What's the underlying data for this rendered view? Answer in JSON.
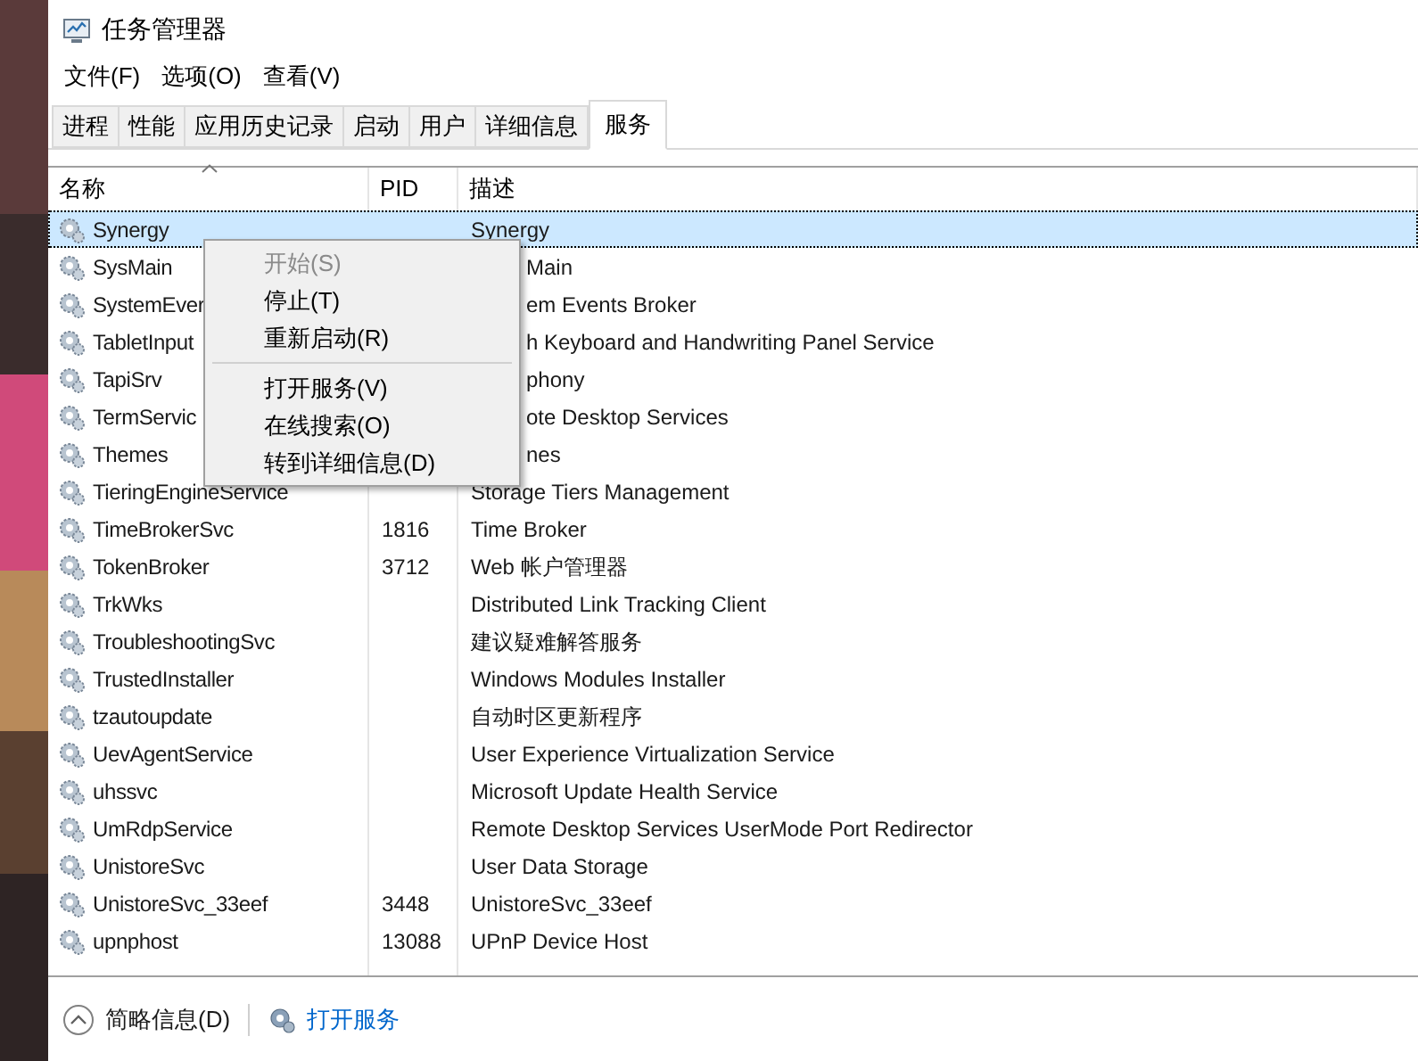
{
  "window": {
    "title": "任务管理器"
  },
  "menu_bar": [
    "文件(F)",
    "选项(O)",
    "查看(V)"
  ],
  "tabs": [
    {
      "label": "进程",
      "selected": false
    },
    {
      "label": "性能",
      "selected": false
    },
    {
      "label": "应用历史记录",
      "selected": false
    },
    {
      "label": "启动",
      "selected": false
    },
    {
      "label": "用户",
      "selected": false
    },
    {
      "label": "详细信息",
      "selected": false
    },
    {
      "label": "服务",
      "selected": true
    }
  ],
  "table": {
    "columns": [
      "名称",
      "PID",
      "描述"
    ],
    "rows": [
      {
        "name": "Synergy",
        "description": "Synergy",
        "selected": true
      },
      {
        "name": "SysMain",
        "description": "Main",
        "selected": false
      },
      {
        "name": "SystemEver",
        "description": "em Events Broker",
        "selected": false
      },
      {
        "name": "TabletInput",
        "description": "h Keyboard and Handwriting Panel Service",
        "selected": false
      },
      {
        "name": "TapiSrv",
        "description": "phony",
        "selected": false
      },
      {
        "name": "TermServic",
        "description": "ote Desktop Services",
        "selected": false
      },
      {
        "name": "Themes",
        "description": "nes",
        "selected": false
      },
      {
        "name": "TieringEngineService",
        "description": "Storage Tiers Management",
        "selected": false
      },
      {
        "name": "TimeBrokerSvc",
        "pid": "1816",
        "description": "Time Broker",
        "selected": false
      },
      {
        "name": "TokenBroker",
        "pid": "3712",
        "description": "Web 帐户管理器",
        "selected": false
      },
      {
        "name": "TrkWks",
        "description": "Distributed Link Tracking Client",
        "selected": false
      },
      {
        "name": "TroubleshootingSvc",
        "description": "建议疑难解答服务",
        "selected": false
      },
      {
        "name": "TrustedInstaller",
        "description": "Windows Modules Installer",
        "selected": false
      },
      {
        "name": "tzautoupdate",
        "description": "自动时区更新程序",
        "selected": false
      },
      {
        "name": "UevAgentService",
        "description": "User Experience Virtualization Service",
        "selected": false
      },
      {
        "name": "uhssvc",
        "description": "Microsoft Update Health Service",
        "selected": false
      },
      {
        "name": "UmRdpService",
        "description": "Remote Desktop Services UserMode Port Redirector",
        "selected": false
      },
      {
        "name": "UnistoreSvc",
        "description": "User Data Storage",
        "selected": false
      },
      {
        "name": "UnistoreSvc_33eef",
        "pid": "3448",
        "description": "UnistoreSvc_33eef",
        "selected": false
      },
      {
        "name": "upnphost",
        "pid": "13088",
        "description": "UPnP Device Host",
        "selected": false
      }
    ]
  },
  "context_menu": [
    {
      "label": "开始(S)",
      "disabled": true,
      "kind": "item"
    },
    {
      "label": "停止(T)",
      "disabled": false,
      "kind": "item"
    },
    {
      "label": "重新启动(R)",
      "disabled": false,
      "kind": "item"
    },
    {
      "kind": "separator"
    },
    {
      "label": "打开服务(V)",
      "disabled": false,
      "kind": "item"
    },
    {
      "label": "在线搜索(O)",
      "disabled": false,
      "kind": "item"
    },
    {
      "label": "转到详细信息(D)",
      "disabled": false,
      "kind": "item"
    }
  ],
  "footer": {
    "details_toggle": "简略信息(D)",
    "open_services_link": "打开服务"
  }
}
